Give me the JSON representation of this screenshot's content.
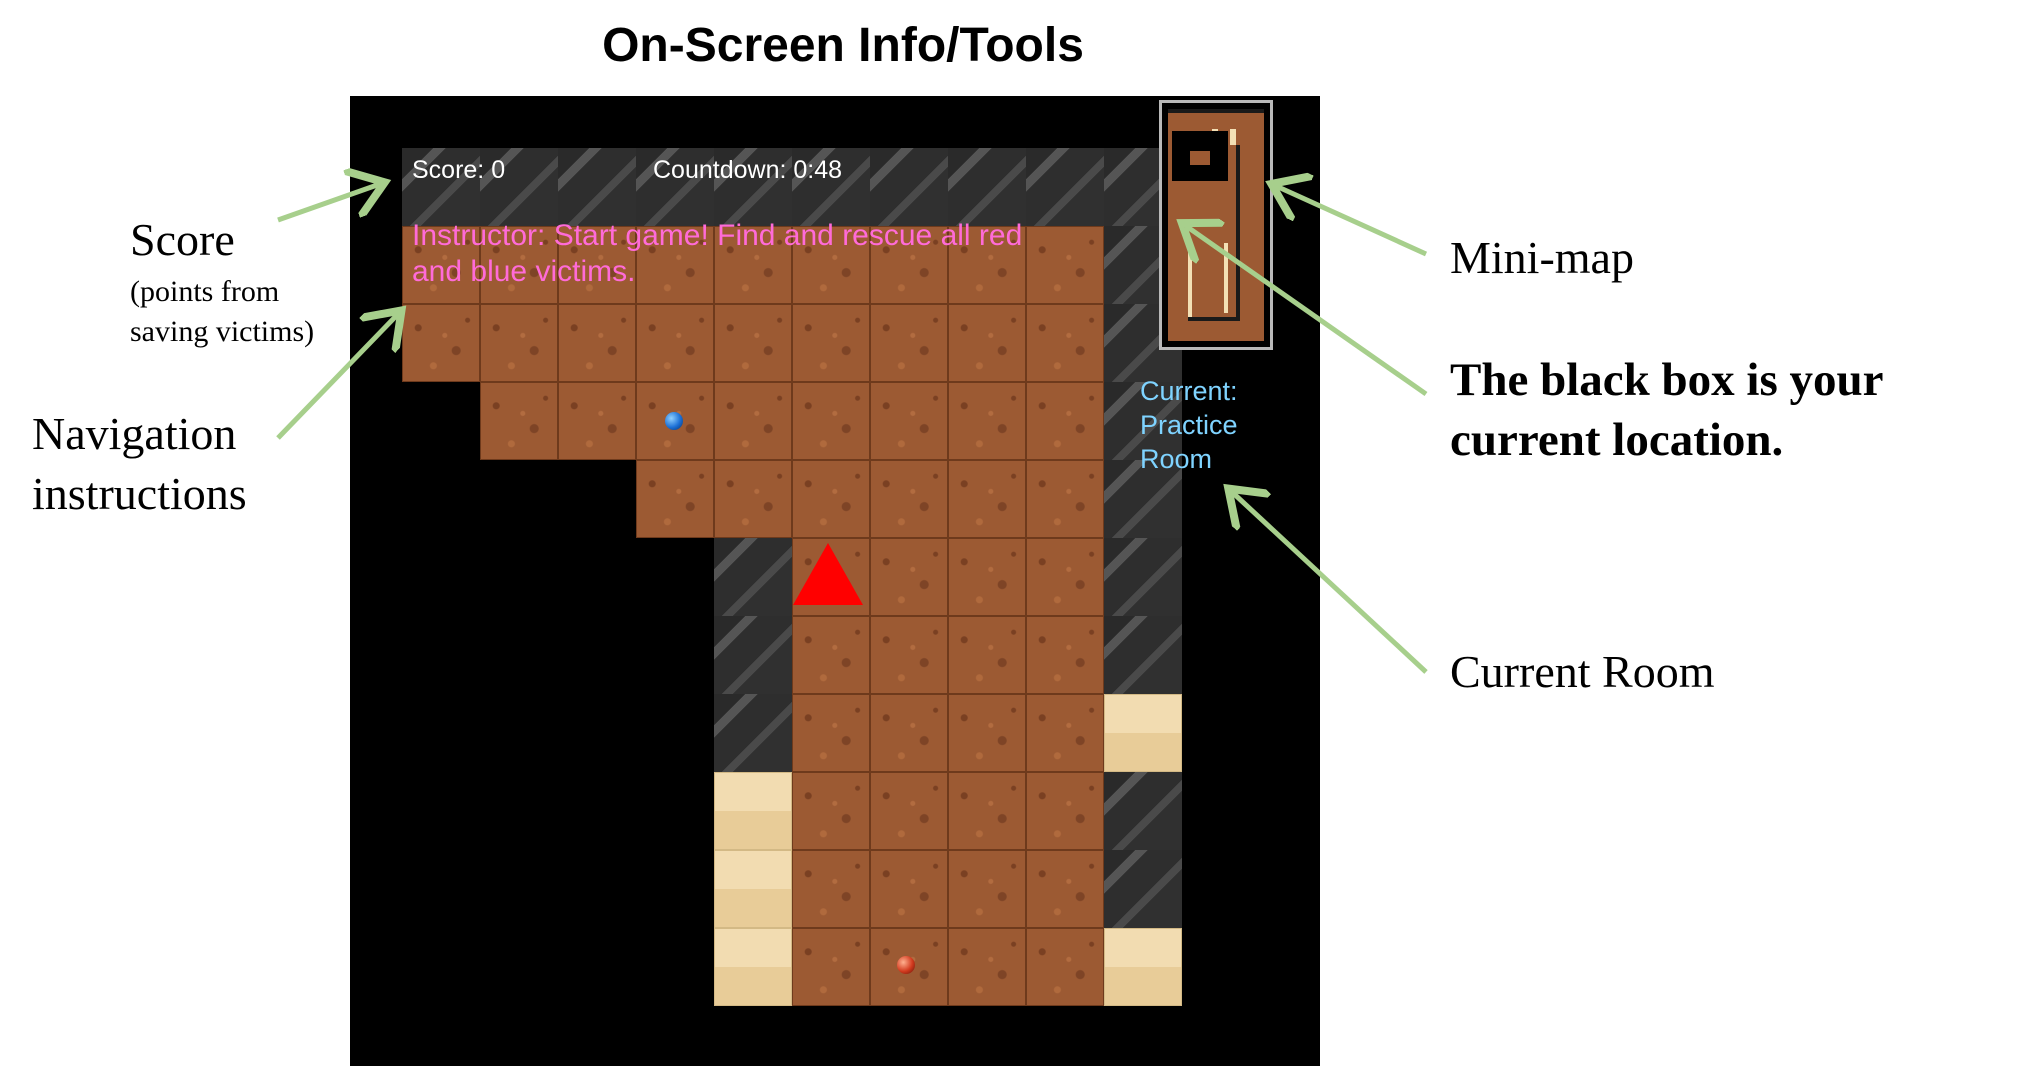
{
  "figure": {
    "title": "On-Screen Info/Tools"
  },
  "hud": {
    "score": "Score: 0",
    "countdown": "Countdown: 0:48",
    "instructor": "Instructor: Start game! Find and rescue all red and blue victims.",
    "room": [
      "Current:",
      "Practice",
      "Room"
    ]
  },
  "annotations": {
    "score": "Score",
    "score_sub": [
      "(points from",
      "saving victims)"
    ],
    "nav": [
      "Navigation",
      "instructions"
    ],
    "minimap": "Mini-map",
    "location": [
      "The black box is your",
      "current location."
    ],
    "room": "Current Room"
  },
  "colors": {
    "player": "#ff0000",
    "victim_red": "#d23a1e",
    "victim_blue": "#1b6fd6",
    "instructor_text": "#ff6bd8",
    "room_text": "#7fd3ff",
    "arrow": "#a7cf8c"
  },
  "icons": {
    "player": "red-triangle",
    "victim_red": "red-orb",
    "victim_blue": "blue-orb"
  }
}
